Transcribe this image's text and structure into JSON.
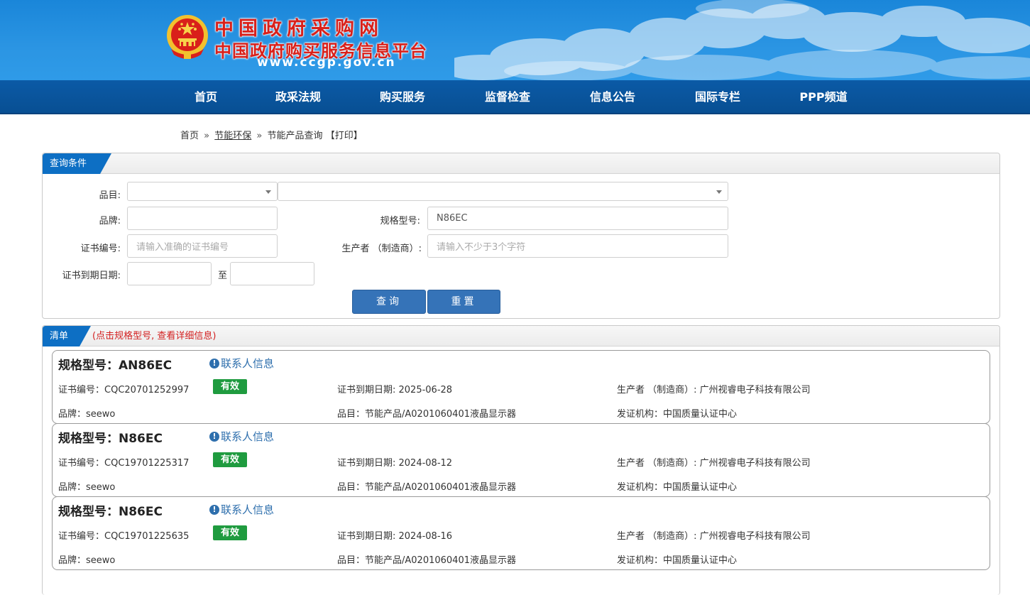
{
  "header": {
    "title_line1": "中国政府采购网",
    "title_line2": "中国政府购买服务信息平台",
    "url": "www.ccgp.gov.cn"
  },
  "nav": {
    "items": [
      {
        "label": "首页"
      },
      {
        "label": "政采法规"
      },
      {
        "label": "购买服务"
      },
      {
        "label": "监督检查"
      },
      {
        "label": "信息公告"
      },
      {
        "label": "国际专栏"
      },
      {
        "label": "PPP频道"
      }
    ]
  },
  "breadcrumb": {
    "home": "首页",
    "sep": "»",
    "section": "节能环保",
    "current": "节能产品查询",
    "print": "【打印】"
  },
  "query": {
    "panel_title": "查询条件",
    "category_label": "品目:",
    "category_value": "",
    "subcategory_value": "",
    "brand_label": "品牌:",
    "brand_value": "",
    "model_label": "规格型号:",
    "model_value": "N86EC",
    "cert_label": "证书编号:",
    "cert_placeholder": "请输入准确的证书编号",
    "maker_label": "生产者 （制造商）:",
    "maker_placeholder": "请输入不少于3个字符",
    "expiry_label": "证书到期日期:",
    "expiry_from": "",
    "expiry_to_label": "至",
    "expiry_to": "",
    "search_button": "查询",
    "reset_button": "重置"
  },
  "list": {
    "panel_title": "清单",
    "hint": "(点击规格型号, 查看详细信息)",
    "contact_label": "联系人信息",
    "model_prefix": "规格型号：",
    "cert_prefix": "证书编号：",
    "expiry_prefix": "证书到期日期: ",
    "maker_prefix": "生产者 （制造商）: ",
    "brand_prefix": "品牌：",
    "category_prefix": "品目：",
    "issuer_prefix": "发证机构：",
    "items": [
      {
        "model": "AN86EC",
        "cert_no": "CQC20701252997",
        "status": "有效",
        "expiry": "2025-06-28",
        "maker": "广州视睿电子科技有限公司",
        "brand": "seewo",
        "category": "节能产品/A0201060401液晶显示器",
        "issuer": "中国质量认证中心"
      },
      {
        "model": "N86EC",
        "cert_no": "CQC19701225317",
        "status": "有效",
        "expiry": "2024-08-12",
        "maker": "广州视睿电子科技有限公司",
        "brand": "seewo",
        "category": "节能产品/A0201060401液晶显示器",
        "issuer": "中国质量认证中心"
      },
      {
        "model": "N86EC",
        "cert_no": "CQC19701225635",
        "status": "有效",
        "expiry": "2024-08-16",
        "maker": "广州视睿电子科技有限公司",
        "brand": "seewo",
        "category": "节能产品/A0201060401液晶显示器",
        "issuer": "中国质量认证中心"
      }
    ]
  }
}
